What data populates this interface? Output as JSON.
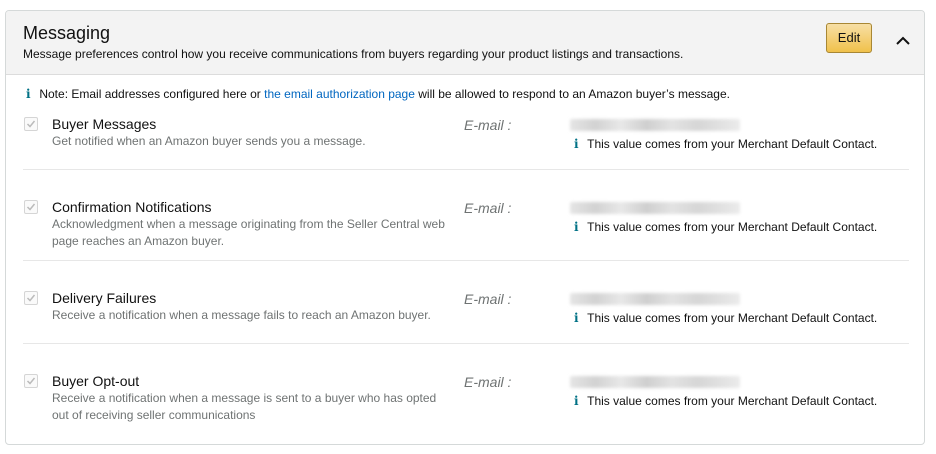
{
  "header": {
    "title": "Messaging",
    "subtitle": "Message preferences control how you receive communications from buyers regarding your product listings and transactions.",
    "edit_label": "Edit"
  },
  "note": {
    "prefix": "Note: Email addresses configured here or ",
    "link": "the email authorization page",
    "suffix": " will be allowed to respond to an Amazon buyer’s message."
  },
  "email_label": "E-mail :",
  "default_contact_note": "This value comes from your Merchant Default Contact.",
  "rows": [
    {
      "title": "Buyer Messages",
      "description": "Get notified when an Amazon buyer sends you a message.",
      "checked": true
    },
    {
      "title": "Confirmation Notifications",
      "description": "Acknowledgment when a message originating from the Seller Central web page reaches an Amazon buyer.",
      "checked": true
    },
    {
      "title": "Delivery Failures",
      "description": "Receive a notification when a message fails to reach an Amazon buyer.",
      "checked": true
    },
    {
      "title": "Buyer Opt-out",
      "description": "Receive a notification when a message is sent to a buyer who has opted out of receiving seller communications",
      "checked": true
    }
  ],
  "colors": {
    "accent_link": "#0066c0",
    "info_icon": "#007185",
    "edit_button": "#f0c14b"
  }
}
